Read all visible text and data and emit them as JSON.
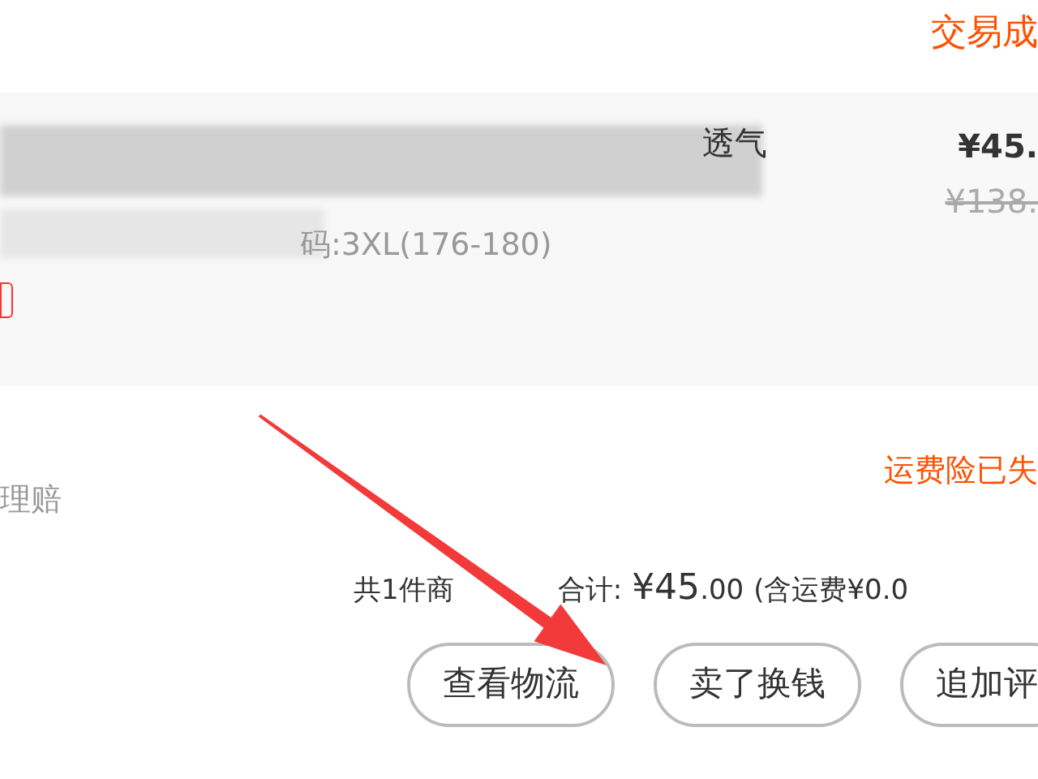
{
  "order": {
    "status": "交易成"
  },
  "item": {
    "title_end": "透气",
    "spec": "码:3XL(176-180)",
    "price": "¥45.",
    "original_price": "¥138."
  },
  "service": {
    "label": "理赔",
    "insurance_status": "运费险已失"
  },
  "summary": {
    "count": "共1件商",
    "total_label": "合计:",
    "total_major": "¥45",
    "total_minor": ".00",
    "shipping": "(含运费¥0.0"
  },
  "actions": [
    {
      "label": "查看物流"
    },
    {
      "label": "卖了换钱"
    },
    {
      "label": "追加评"
    }
  ]
}
